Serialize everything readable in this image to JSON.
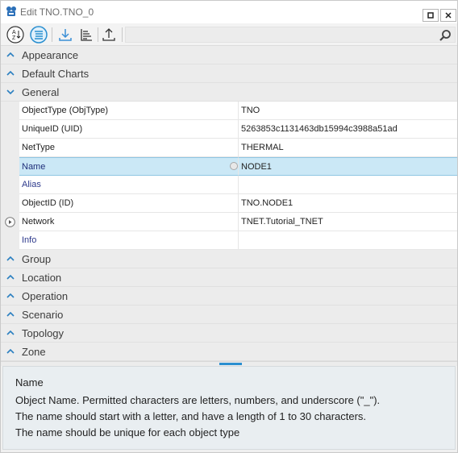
{
  "window": {
    "title": "Edit TNO.TNO_0",
    "restore_label": "restore",
    "close_label": "close"
  },
  "toolbar": {
    "buttons": [
      {
        "name": "sort-alphabetical-button",
        "icon": "sort-az-icon",
        "active": false
      },
      {
        "name": "sort-categorized-button",
        "icon": "categorized-icon",
        "active": true
      },
      {
        "name": "import-button",
        "icon": "download-icon",
        "active": false
      },
      {
        "name": "hierarchy-button",
        "icon": "hierarchy-icon",
        "active": false
      },
      {
        "name": "export-button",
        "icon": "upload-icon",
        "active": false
      }
    ],
    "search": {
      "value": "",
      "placeholder": ""
    }
  },
  "categories_top": [
    {
      "label": "Appearance",
      "expanded": false
    },
    {
      "label": "Default Charts",
      "expanded": false
    },
    {
      "label": "General",
      "expanded": true
    }
  ],
  "general_properties": [
    {
      "name": "ObjectType (ObjType)",
      "value": "TNO",
      "style": "normal",
      "selected": false,
      "expandable": false
    },
    {
      "name": "UniqueID (UID)",
      "value": "5263853c1131463db15994c3988a51ad",
      "style": "normal",
      "selected": false,
      "expandable": false
    },
    {
      "name": "NetType",
      "value": "THERMAL",
      "style": "normal",
      "selected": false,
      "expandable": false
    },
    {
      "name": "Name",
      "value": "NODE1",
      "style": "blue",
      "selected": true,
      "expandable": false
    },
    {
      "name": "Alias",
      "value": "",
      "style": "blue",
      "selected": false,
      "expandable": false
    },
    {
      "name": "ObjectID (ID)",
      "value": "TNO.NODE1",
      "style": "normal",
      "selected": false,
      "expandable": false
    },
    {
      "name": "Network",
      "value": "TNET.Tutorial_TNET",
      "style": "normal",
      "selected": false,
      "expandable": true
    },
    {
      "name": "Info",
      "value": "",
      "style": "blue",
      "selected": false,
      "expandable": false
    }
  ],
  "categories_bottom": [
    {
      "label": "Group",
      "expanded": false
    },
    {
      "label": "Location",
      "expanded": false
    },
    {
      "label": "Operation",
      "expanded": false
    },
    {
      "label": "Scenario",
      "expanded": false
    },
    {
      "label": "Topology",
      "expanded": false
    },
    {
      "label": "Zone",
      "expanded": false
    }
  ],
  "description": {
    "title": "Name",
    "lines": [
      "Object Name. Permitted characters are letters, numbers, and underscore (\"_\").",
      "The name should start with a letter, and have a length of 1 to 30 characters.",
      "The name should be unique for each object type"
    ]
  },
  "colors": {
    "accent": "#2a8fd0",
    "selection": "#cbe8f6",
    "category_bg": "#ececec",
    "description_bg": "#e9eef1"
  }
}
